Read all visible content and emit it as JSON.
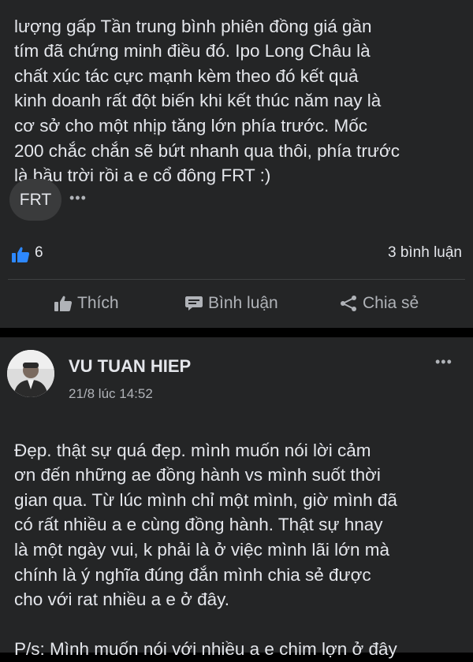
{
  "post1": {
    "text_lines": [
      "lượng gấp  Tần trung bình phiên đồng giá gần",
      "tím đã chứng minh điều đó. Ipo Long Châu là",
      "chất xúc tác cực mạnh kèm theo đó kết quả",
      "kinh doanh rất đột biến khi kết thúc năm nay là",
      "cơ sở cho một nhịp tăng lớn phía trước. Mốc",
      "200 chắc chắn sẽ bứt nhanh qua thôi, phía trước",
      "là bầu trời rồi a e cổ đông FRT :)"
    ],
    "tag": "FRT",
    "more": "•••",
    "like_count": "6",
    "comment_count": "3 bình luận",
    "actions": {
      "like": "Thích",
      "comment": "Bình luận",
      "share": "Chia sẻ"
    }
  },
  "post2": {
    "author": "VU TUAN HIEP",
    "time": "21/8 lúc 14:52",
    "more": "•••",
    "text_lines": [
      "Đẹp. thật sự quá đẹp. mình muốn nói lời cảm",
      "ơn đến những ae đồng hành vs mình suốt thời",
      "gian qua. Từ lúc mình chỉ một mình, giờ mình đã",
      "có rất nhiều a e cùng đồng hành. Thật sự hnay",
      "là một ngày vui, k phải là ở việc mình lãi lớn mà",
      "chính là ý nghĩa đúng đắn mình chia sẻ được",
      "cho với rat nhiều a e ở đây.",
      "",
      "P/s: Mình muốn nói với nhiều a e chim lợn ở đây"
    ]
  },
  "colors": {
    "background": "#000000",
    "card": "#242526",
    "text": "#e4e6eb",
    "muted": "#b0b3b8",
    "like_blue": "#2d88ff"
  },
  "icons": {
    "like_reaction": "thumbs-up-icon",
    "like_action": "thumbs-up-outline-icon",
    "comment_action": "comment-bubble-icon",
    "share_action": "share-icon",
    "more": "more-dots-icon"
  }
}
